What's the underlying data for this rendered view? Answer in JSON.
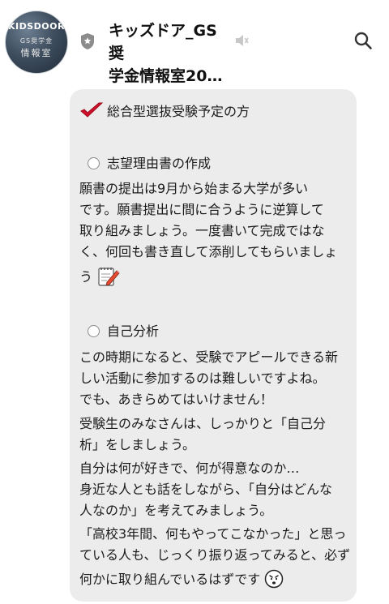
{
  "header": {
    "avatar": {
      "brand": "KIDSDOOR",
      "line1": "GS奨学金",
      "line2": "情報室"
    },
    "title_line1": "キッズドア_GS奨",
    "title_line2": "学金情報室20…"
  },
  "message": {
    "heading": "総合型選抜受験予定の方",
    "section1": {
      "title": "志望理由書の作成",
      "lines": [
        "願書の提出は9月から始まる大学が多い",
        "です。願書提出に間に合うように逆算して",
        "取り組みましょう。一度書いて完成ではな",
        "く、何回も書き直して添削してもらいましょ",
        "う"
      ]
    },
    "section2": {
      "title": "自己分析",
      "lines": [
        "この時期になると、受験でアピールできる新",
        "しい活動に参加するのは難しいですよね。",
        "でも、あきらめてはいけません！",
        "受験生のみなさんは、しっかりと「自己分",
        "析」をしましょう。",
        "自分は何が好きで、何が得意なのか…",
        "身近な人とも話をしながら、「自分はどんな",
        "人なのか」を考えてみましょう。",
        "「高校3年間、何もやってこなかった」と思っ",
        "ている人も、じっくり振り返ってみると、必ず",
        "何かに取り組んでいるはずです"
      ]
    }
  },
  "colors": {
    "bubble": "#ececec",
    "check": "#d0102a"
  }
}
